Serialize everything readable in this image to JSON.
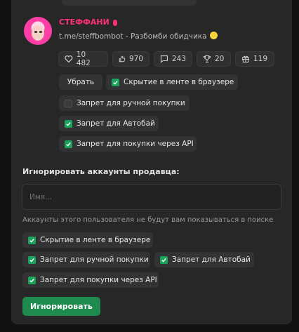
{
  "profile": {
    "username": "СТЕФФАНИ",
    "bio": "t.me/steffbombot - Разбомби обидчика"
  },
  "stats": {
    "likes": "10 482",
    "thumbs": "970",
    "messages": "243",
    "trophies": "20",
    "gifts": "119"
  },
  "item_actions": {
    "remove_label": "Убрать",
    "hide_feed_label": "Скрытие в ленте в браузере",
    "block_manual_label": "Запрет для ручной покупки",
    "block_autobuy_label": "Запрет для Автобай",
    "block_api_label": "Запрет для покупки через API",
    "hide_feed_checked": true,
    "block_manual_checked": false,
    "block_autobuy_checked": true,
    "block_api_checked": true
  },
  "ignore_seller": {
    "title": "Игнорировать аккаунты продавца:",
    "input_placeholder": "Имя...",
    "input_value": "",
    "hint": "Аккаунты этого пользователя не будут вам показываться в поиске",
    "hide_feed_label": "Скрытие в ленте в браузере",
    "block_manual_label": "Запрет для ручной покупки",
    "block_autobuy_label": "Запрет для Автобай",
    "block_api_label": "Запрет для покупки через API",
    "hide_feed_checked": true,
    "block_manual_checked": true,
    "block_autobuy_checked": true,
    "block_api_checked": true,
    "submit_label": "Игнорировать"
  },
  "colors": {
    "accent_green": "#19a35c",
    "button_green": "#1f8a4e",
    "username_pink": "#ff2f79"
  }
}
